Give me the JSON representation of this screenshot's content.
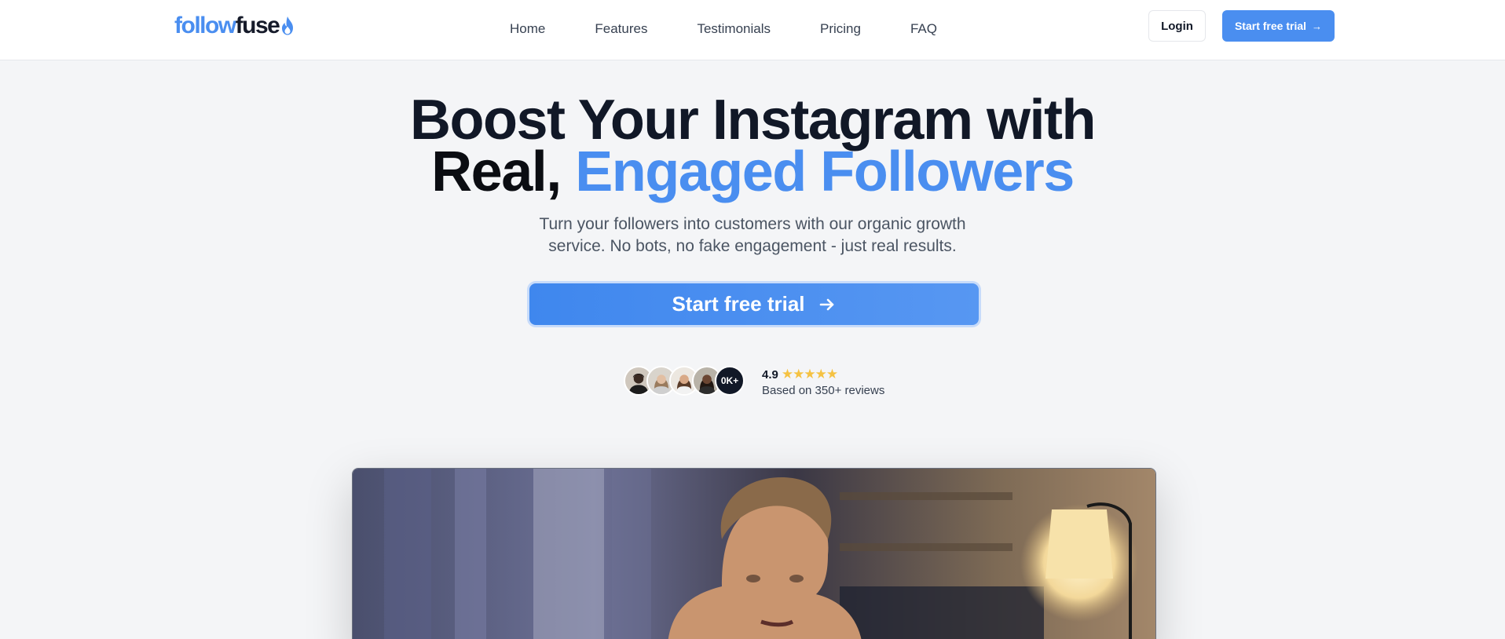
{
  "brand": {
    "logo_part1": "follow",
    "logo_part2": "fuse",
    "accent_color": "#4a8ef0",
    "logo_icon": "flame-icon"
  },
  "nav": {
    "links": [
      "Home",
      "Features",
      "Testimonials",
      "Pricing",
      "FAQ"
    ],
    "login_label": "Login",
    "cta_label": "Start free trial",
    "cta_icon": "arrow-right-icon"
  },
  "hero": {
    "title_line1": "Boost Your Instagram with",
    "title_line2_plain": "Real, ",
    "title_line2_accent": "Engaged Followers",
    "subtitle": "Turn your followers into customers with our organic growth service. No bots, no fake engagement - just real results.",
    "cta_label": "Start free trial",
    "cta_icon": "arrow-right-icon"
  },
  "social_proof": {
    "avatar_count": 4,
    "count_badge": "0K+",
    "rating": "4.9",
    "stars": "★★★★★",
    "rating_fraction": 1.0,
    "reviews_text": "Based on 350+ reviews",
    "star_color": "#f5c242"
  },
  "video": {
    "icon": "video-thumbnail-icon"
  }
}
